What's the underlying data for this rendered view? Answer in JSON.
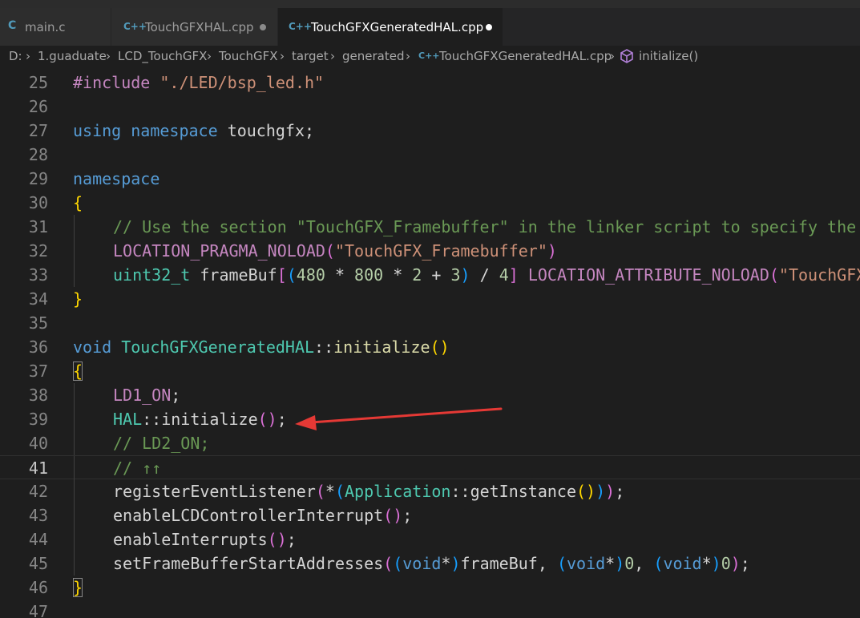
{
  "tabs": [
    {
      "icon": "C",
      "label": "main.c",
      "modified": false,
      "active": false
    },
    {
      "icon": "C++",
      "label": "TouchGFXHAL.cpp",
      "modified": true,
      "active": false
    },
    {
      "icon": "C++",
      "label": "TouchGFXGeneratedHAL.cpp",
      "modified": true,
      "active": true
    }
  ],
  "breadcrumb": {
    "items": [
      "D:",
      "1.guaduate",
      "LCD_TouchGFX",
      "TouchGFX",
      "target",
      "generated"
    ],
    "file_icon": "C++",
    "file": "TouchGFXGeneratedHAL.cpp",
    "symbol_icon": "method-cube-icon",
    "symbol": "initialize()"
  },
  "editor": {
    "line_numbers": [
      "25",
      "26",
      "27",
      "28",
      "29",
      "30",
      "31",
      "32",
      "33",
      "34",
      "35",
      "36",
      "37",
      "38",
      "39",
      "40",
      "41",
      "42",
      "43",
      "44",
      "45",
      "46",
      "47"
    ],
    "current_line": "41",
    "lines": {
      "l25": {
        "a": "#include",
        "b": " ",
        "c": "\"./LED/bsp_led.h\""
      },
      "l27": {
        "a": "using",
        "b": " ",
        "c": "namespace",
        "d": " ",
        "e": "touchgfx",
        "f": ";"
      },
      "l29": {
        "a": "namespace"
      },
      "l30": {
        "a": "{"
      },
      "l31": {
        "a": "// Use the section \"TouchGFX_Framebuffer\" in the linker script to specify the"
      },
      "l32": {
        "a": "LOCATION_PRAGMA_NOLOAD",
        "b": "(",
        "c": "\"TouchGFX_Framebuffer\"",
        "d": ")"
      },
      "l33": {
        "a": "uint32_t",
        "b": " frameBuf",
        "c": "[",
        "d": "(",
        "e": "480",
        "f": " * ",
        "g": "800",
        "h": " * ",
        "i": "2",
        "j": " + ",
        "k": "3",
        "l": ")",
        "m": " / ",
        "n": "4",
        "o": "]",
        "p": " ",
        "q": "LOCATION_ATTRIBUTE_NOLOAD",
        "r": "(",
        "s": "\"TouchGFX_Framebuffer\""
      },
      "l34": {
        "a": "}"
      },
      "l36": {
        "a": "void",
        "b": " ",
        "c": "TouchGFXGeneratedHAL",
        "d": "::",
        "e": "initialize",
        "f": "()"
      },
      "l37": {
        "a": "{"
      },
      "l38": {
        "a": "LD1_ON",
        "b": ";"
      },
      "l39": {
        "a": "HAL",
        "b": "::",
        "c": "initialize",
        "d": "()",
        "e": ";"
      },
      "l40": {
        "a": "// LD2_ON;"
      },
      "l41": {
        "a": "// ↑↑"
      },
      "l42": {
        "a": "registerEventListener",
        "b": "(",
        "c": "*",
        "d": "(",
        "e": "Application",
        "f": "::",
        "g": "getInstance",
        "h": "()",
        "i": ")",
        "j": ")",
        "k": ";"
      },
      "l43": {
        "a": "enableLCDControllerInterrupt",
        "b": "()",
        "c": ";"
      },
      "l44": {
        "a": "enableInterrupts",
        "b": "()",
        "c": ";"
      },
      "l45": {
        "a": "setFrameBufferStartAddresses",
        "b": "(",
        "c": "(",
        "d": "void",
        "e": "*",
        "f": ")",
        "g": "frameBuf",
        "h": ", ",
        "i": "(",
        "j": "void",
        "k": "*",
        "l": ")",
        "m": "0",
        "n": ", ",
        "o": "(",
        "p": "void",
        "q": "*",
        "r": ")",
        "s": "0",
        "t": ")",
        "u": ";"
      },
      "l46": {
        "a": "}"
      }
    }
  },
  "colors": {
    "background": "#1e1e1e",
    "annotation_arrow": "#e53935"
  }
}
